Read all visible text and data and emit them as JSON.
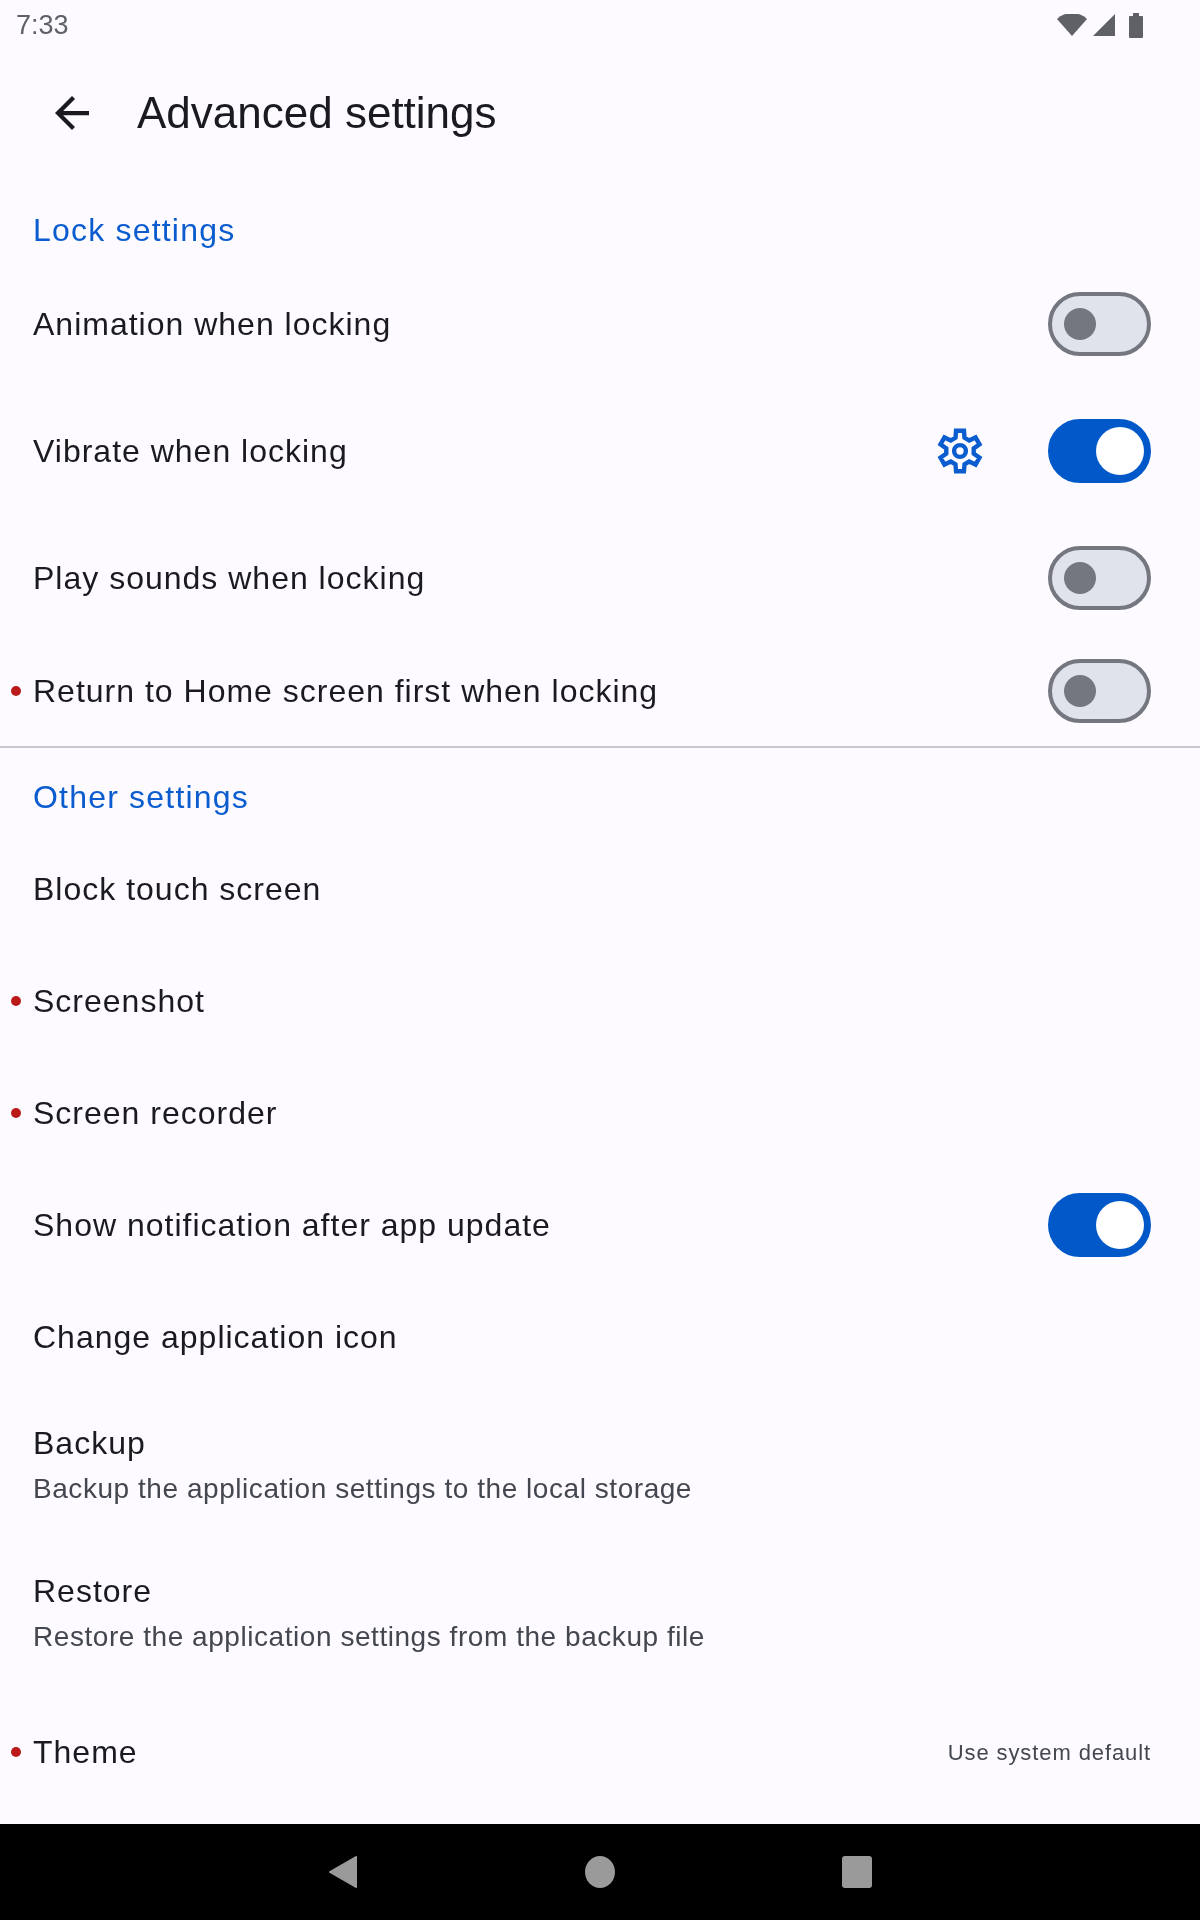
{
  "status_bar": {
    "time": "7:33"
  },
  "app_bar": {
    "title": "Advanced settings"
  },
  "sections": [
    {
      "title": "Lock settings",
      "items": [
        {
          "kind": "switch",
          "label": "Animation when locking",
          "dot": false,
          "settings_button": false,
          "on": false
        },
        {
          "kind": "switch",
          "label": "Vibrate when locking",
          "dot": false,
          "settings_button": true,
          "on": true
        },
        {
          "kind": "switch",
          "label": "Play sounds when locking",
          "dot": false,
          "settings_button": false,
          "on": false
        },
        {
          "kind": "switch",
          "label": "Return to Home screen first when locking",
          "dot": true,
          "settings_button": false,
          "on": false
        }
      ]
    },
    {
      "title": "Other settings",
      "items": [
        {
          "kind": "action",
          "label": "Block touch screen",
          "dot": false,
          "settings_button": false
        },
        {
          "kind": "action",
          "label": "Screenshot",
          "dot": true,
          "settings_button": false
        },
        {
          "kind": "action",
          "label": "Screen recorder",
          "dot": true,
          "settings_button": false
        },
        {
          "kind": "switch",
          "label": "Show notification after app update",
          "dot": false,
          "settings_button": false,
          "on": true
        },
        {
          "kind": "action",
          "label": "Change application icon",
          "dot": false,
          "settings_button": false
        },
        {
          "kind": "action",
          "label": "Backup",
          "subtitle": "Backup the application settings to the local storage",
          "dot": false,
          "settings_button": false
        },
        {
          "kind": "action",
          "label": "Restore",
          "subtitle": "Restore the application settings from the backup file",
          "dot": false,
          "settings_button": false
        },
        {
          "kind": "value",
          "label": "Theme",
          "value": "Use system default",
          "dot": true,
          "settings_button": false
        }
      ]
    }
  ]
}
